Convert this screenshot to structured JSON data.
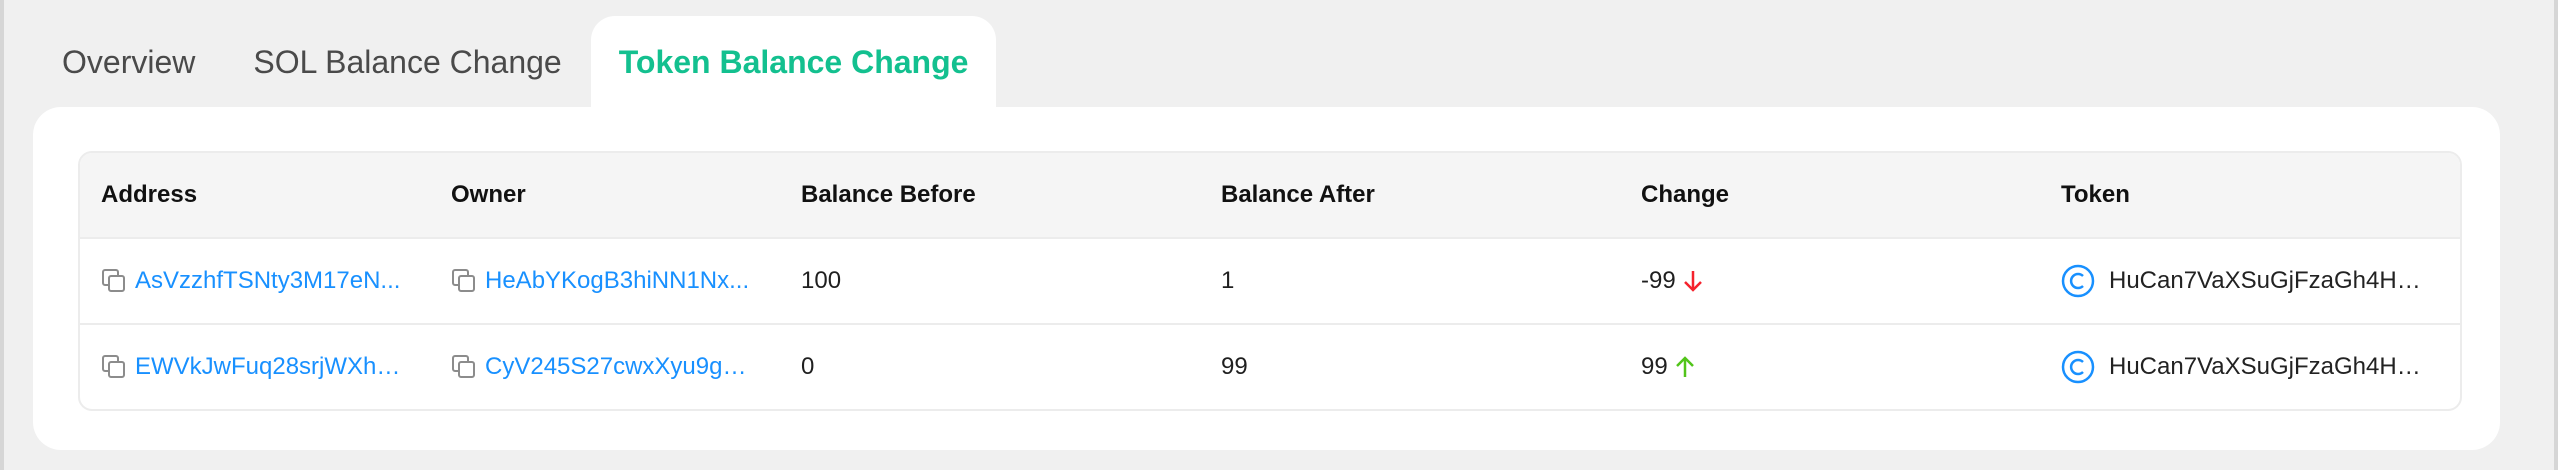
{
  "tabs": [
    {
      "label": "Overview",
      "active": false
    },
    {
      "label": "SOL Balance Change",
      "active": false
    },
    {
      "label": "Token Balance Change",
      "active": true
    }
  ],
  "colors": {
    "accent": "#13c08f",
    "link": "#1890ff",
    "decrease": "#f5222d",
    "increase": "#52c41a"
  },
  "table": {
    "headers": [
      "Address",
      "Owner",
      "Balance Before",
      "Balance After",
      "Change",
      "Token"
    ],
    "rows": [
      {
        "address": "AsVzzhfTSNty3M17eN...",
        "owner": "HeAbYKogB3hiNN1Nx...",
        "before": "100",
        "after": "1",
        "change": "-99",
        "direction": "down",
        "token": "HuCan7VaXSuGjFzaGh4Hw..."
      },
      {
        "address": "EWVkJwFuq28srjWXhJ...",
        "owner": "CyV245S27cwxXyu9g3...",
        "before": "0",
        "after": "99",
        "change": "99",
        "direction": "up",
        "token": "HuCan7VaXSuGjFzaGh4Hw..."
      }
    ]
  },
  "icons": {
    "copy": "copy-icon",
    "arrow_down": "arrow-down-icon",
    "arrow_up": "arrow-up-icon",
    "token": "token-c-icon"
  }
}
